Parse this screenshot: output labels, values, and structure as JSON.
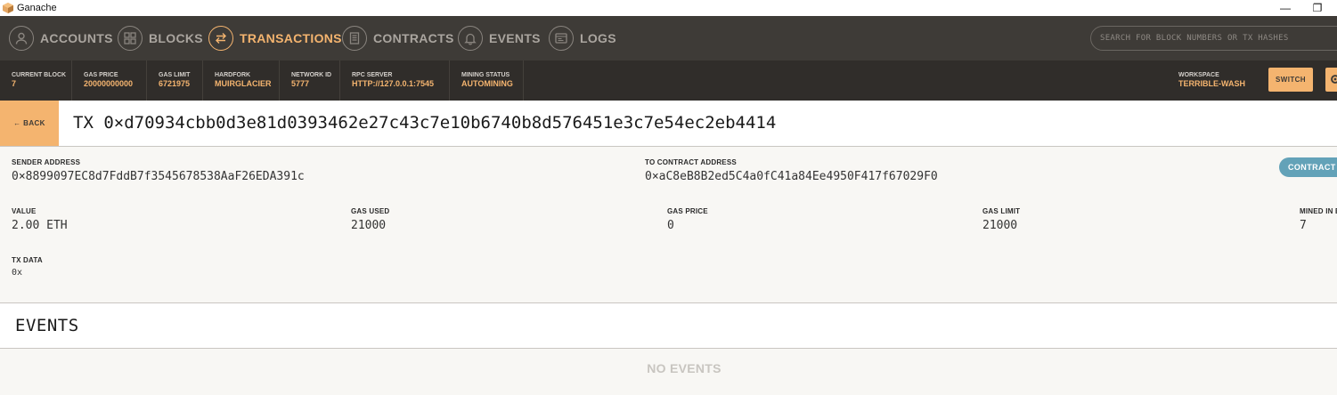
{
  "window": {
    "title": "Ganache",
    "minimize_glyph": "—",
    "restore_glyph": "❐"
  },
  "nav": {
    "items": [
      {
        "label": "ACCOUNTS",
        "icon": "account-icon"
      },
      {
        "label": "BLOCKS",
        "icon": "blocks-icon"
      },
      {
        "label": "TRANSACTIONS",
        "icon": "transactions-icon",
        "active": true
      },
      {
        "label": "CONTRACTS",
        "icon": "contracts-icon"
      },
      {
        "label": "EVENTS",
        "icon": "bell-icon"
      },
      {
        "label": "LOGS",
        "icon": "logs-icon"
      }
    ],
    "search_placeholder": "SEARCH FOR BLOCK NUMBERS OR TX HASHES"
  },
  "status": {
    "current_block": {
      "label": "CURRENT BLOCK",
      "value": "7"
    },
    "gas_price": {
      "label": "GAS PRICE",
      "value": "20000000000"
    },
    "gas_limit": {
      "label": "GAS LIMIT",
      "value": "6721975"
    },
    "hardfork": {
      "label": "HARDFORK",
      "value": "MUIRGLACIER"
    },
    "network_id": {
      "label": "NETWORK ID",
      "value": "5777"
    },
    "rpc_server": {
      "label": "RPC SERVER",
      "value": "HTTP://127.0.0.1:7545"
    },
    "mining_status": {
      "label": "MINING STATUS",
      "value": "AUTOMINING"
    },
    "workspace": {
      "label": "WORKSPACE",
      "value": "TERRIBLE-WASH"
    },
    "switch_label": "SWITCH"
  },
  "tx": {
    "back_label": "← BACK",
    "title": "TX 0×d70934cbb0d3e81d0393462e27c43c7e10b6740b8d576451e3c7e54ec2eb4414",
    "sender_label": "SENDER ADDRESS",
    "sender": "0×8899097EC8d7FddB7f3545678538AaF26EDA391c",
    "to_label": "TO CONTRACT ADDRESS",
    "to": "0×aC8eB8B2ed5C4a0fC41a84Ee4950F417f67029F0",
    "badge": "CONTRACT CALL",
    "value_label": "VALUE",
    "value": "2.00 ETH",
    "gas_used_label": "GAS USED",
    "gas_used": "21000",
    "gas_price_label": "GAS PRICE",
    "gas_price": "0",
    "gas_limit_label": "GAS LIMIT",
    "gas_limit": "21000",
    "mined_label": "MINED IN BLOCK",
    "mined": "7",
    "data_label": "TX DATA",
    "data": "0x"
  },
  "events": {
    "title": "EVENTS",
    "empty": "NO EVENTS"
  },
  "colors": {
    "accent": "#f4b46f",
    "nav_bg": "#3e3b37",
    "status_bg": "#302d2a",
    "badge": "#63a2b8"
  }
}
